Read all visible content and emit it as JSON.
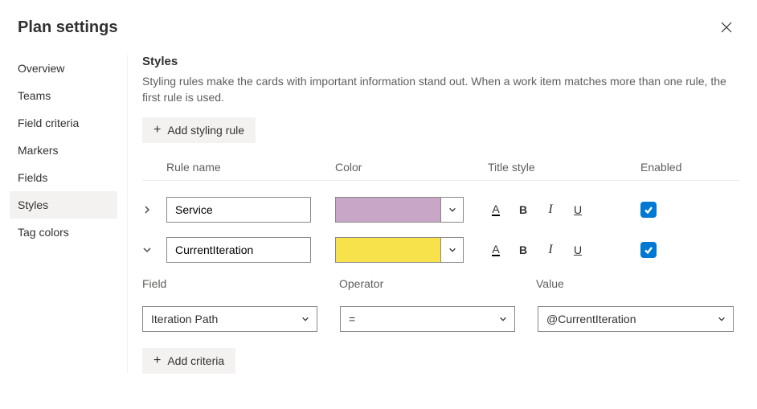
{
  "header": {
    "title": "Plan settings"
  },
  "sidebar": {
    "items": [
      {
        "label": "Overview"
      },
      {
        "label": "Teams"
      },
      {
        "label": "Field criteria"
      },
      {
        "label": "Markers"
      },
      {
        "label": "Fields"
      },
      {
        "label": "Styles"
      },
      {
        "label": "Tag colors"
      }
    ],
    "selectedIndex": 5
  },
  "main": {
    "section_title": "Styles",
    "section_desc": "Styling rules make the cards with important information stand out. When a work item matches more than one rule, the first rule is used.",
    "add_rule_label": "Add styling rule",
    "columns": {
      "rule_name": "Rule name",
      "color": "Color",
      "title_style": "Title style",
      "enabled": "Enabled"
    },
    "rules": [
      {
        "name": "Service",
        "color": "#c8a6c8",
        "expanded": false,
        "enabled": true
      },
      {
        "name": "CurrentIteration",
        "color": "#f7e24b",
        "expanded": true,
        "enabled": true
      }
    ],
    "title_style_glyphs": {
      "a": "A",
      "b": "B",
      "i": "I",
      "u": "U"
    },
    "criteria": {
      "headers": {
        "field": "Field",
        "operator": "Operator",
        "value": "Value"
      },
      "row": {
        "field": "Iteration Path",
        "operator": "=",
        "value": "@CurrentIteration"
      },
      "add_label": "Add criteria"
    }
  }
}
